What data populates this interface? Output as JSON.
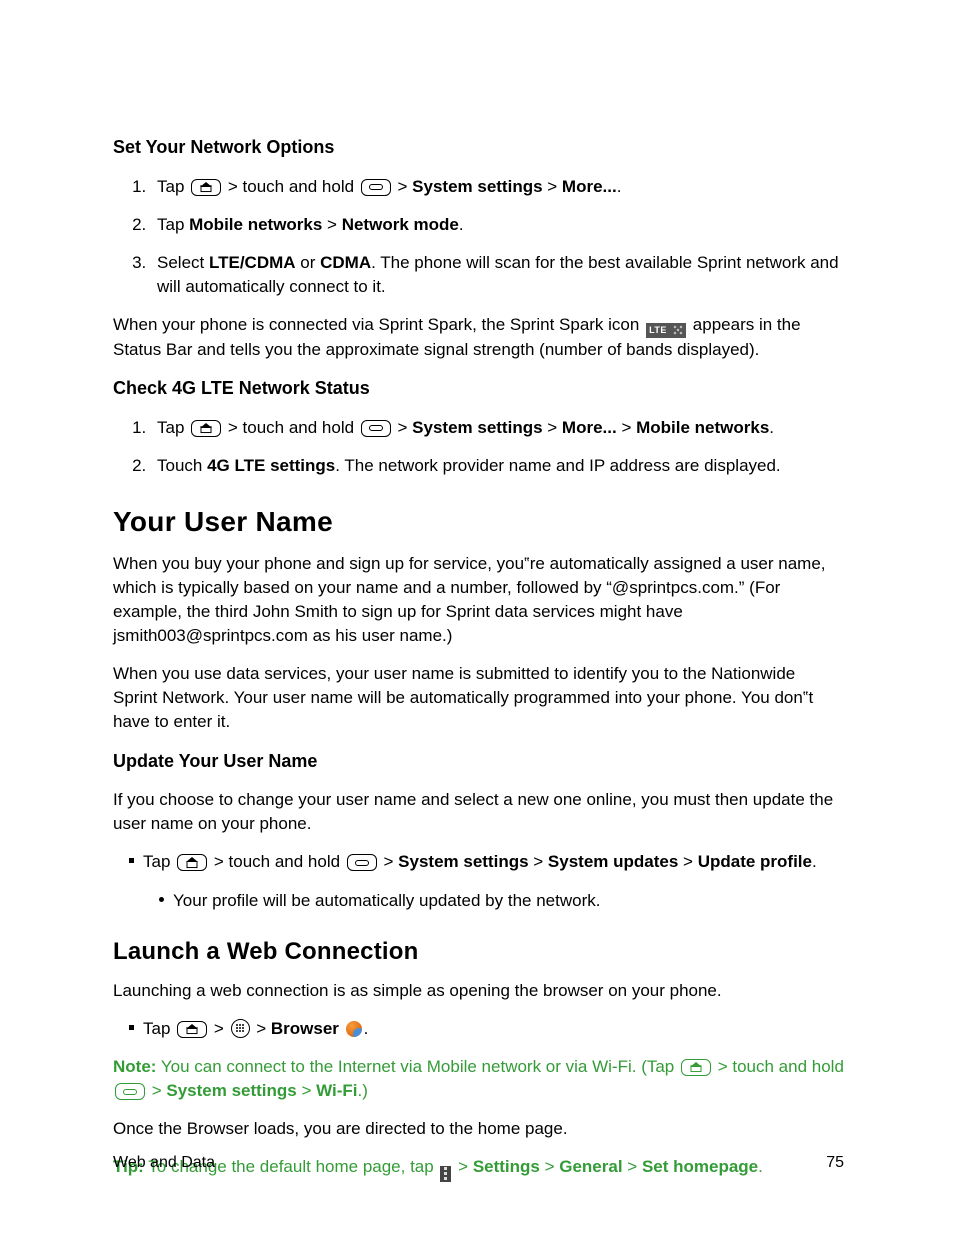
{
  "h_set_network": "Set Your Network Options",
  "s1": {
    "li1_a": "Tap ",
    "li1_b": " > touch and hold ",
    "li1_c": " > ",
    "li1_d": "System settings",
    "li1_e": " > ",
    "li1_f": "More...",
    "li1_g": ".",
    "li2_a": "Tap ",
    "li2_b": "Mobile networks",
    "li2_c": " > ",
    "li2_d": "Network mode",
    "li2_e": ".",
    "li3_a": "Select ",
    "li3_b": "LTE/CDMA",
    "li3_c": " or ",
    "li3_d": "CDMA",
    "li3_e": ". The phone will scan for the best available Sprint network and will automatically connect to it."
  },
  "p_spark_a": "When your phone is connected via Sprint Spark, the Sprint Spark icon ",
  "lte_label": "LTE",
  "p_spark_b": " appears in the Status Bar and tells you the approximate signal strength (number of bands displayed).",
  "h_check_lte": "Check 4G LTE Network Status",
  "s2": {
    "li1_a": "Tap ",
    "li1_b": " > touch and hold ",
    "li1_c": " > ",
    "li1_d": "System settings",
    "li1_e": " > ",
    "li1_f": "More...",
    "li1_g": " > ",
    "li1_h": "Mobile networks",
    "li1_i": ".",
    "li2_a": "Touch ",
    "li2_b": "4G LTE settings",
    "li2_c": ". The network provider name and IP address are displayed."
  },
  "h_user_name": "Your User Name",
  "p_user_1": "When you buy your phone and sign up for service, you‟re automatically assigned a user name, which is typically based on your name and a number, followed by “@sprintpcs.com.” (For example, the third John Smith to sign up for Sprint data services might have jsmith003@sprintpcs.com as his user name.)",
  "p_user_2": "When you use data services, your user name is submitted to identify you to the Nationwide Sprint Network. Your user name will be automatically programmed into your phone. You don‟t have to enter it.",
  "h_update_user": "Update Your User Name",
  "p_update_1": "If you choose to change your user name and select a new one online, you must then update the user name on your phone.",
  "s3": {
    "li1_a": "Tap ",
    "li1_b": " > touch and hold ",
    "li1_c": " > ",
    "li1_d": "System settings",
    "li1_e": " > ",
    "li1_f": "System updates",
    "li1_g": " > ",
    "li1_h": "Update profile",
    "li1_i": ".",
    "sub": "Your profile will be automatically updated by the network."
  },
  "h_launch": "Launch a Web Connection",
  "p_launch_1": "Launching a web connection is as simple as opening the browser on your phone.",
  "s4": {
    "li1_a": "Tap ",
    "li1_b": " > ",
    "li1_c": " > ",
    "li1_d": "Browser",
    "li1_e": " ",
    "li1_f": "."
  },
  "note": {
    "label": "Note:",
    "a": " You can connect to the Internet via Mobile network or via Wi-Fi. (Tap ",
    "b": " > touch and hold ",
    "c": " > ",
    "d": "System settings",
    "e": " > ",
    "f": "Wi-Fi",
    "g": ".)"
  },
  "p_once": "Once the Browser loads, you are directed to the home page.",
  "tip": {
    "label": "Tip:",
    "a": " To change the default home page, tap ",
    "b": " > ",
    "c": "Settings",
    "d": " > ",
    "e": "General",
    "f": " > ",
    "g": "Set homepage",
    "h": "."
  },
  "footer_left": "Web and Data",
  "footer_right": "75"
}
